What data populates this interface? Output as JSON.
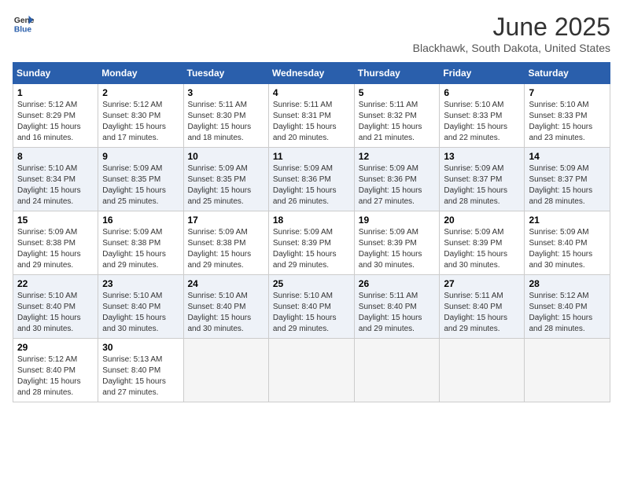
{
  "header": {
    "logo_general": "General",
    "logo_blue": "Blue",
    "title": "June 2025",
    "subtitle": "Blackhawk, South Dakota, United States"
  },
  "weekdays": [
    "Sunday",
    "Monday",
    "Tuesday",
    "Wednesday",
    "Thursday",
    "Friday",
    "Saturday"
  ],
  "weeks": [
    [
      {
        "day": "1",
        "sunrise": "5:12 AM",
        "sunset": "8:29 PM",
        "daylight": "15 hours and 16 minutes."
      },
      {
        "day": "2",
        "sunrise": "5:12 AM",
        "sunset": "8:30 PM",
        "daylight": "15 hours and 17 minutes."
      },
      {
        "day": "3",
        "sunrise": "5:11 AM",
        "sunset": "8:30 PM",
        "daylight": "15 hours and 18 minutes."
      },
      {
        "day": "4",
        "sunrise": "5:11 AM",
        "sunset": "8:31 PM",
        "daylight": "15 hours and 20 minutes."
      },
      {
        "day": "5",
        "sunrise": "5:11 AM",
        "sunset": "8:32 PM",
        "daylight": "15 hours and 21 minutes."
      },
      {
        "day": "6",
        "sunrise": "5:10 AM",
        "sunset": "8:33 PM",
        "daylight": "15 hours and 22 minutes."
      },
      {
        "day": "7",
        "sunrise": "5:10 AM",
        "sunset": "8:33 PM",
        "daylight": "15 hours and 23 minutes."
      }
    ],
    [
      {
        "day": "8",
        "sunrise": "5:10 AM",
        "sunset": "8:34 PM",
        "daylight": "15 hours and 24 minutes."
      },
      {
        "day": "9",
        "sunrise": "5:09 AM",
        "sunset": "8:35 PM",
        "daylight": "15 hours and 25 minutes."
      },
      {
        "day": "10",
        "sunrise": "5:09 AM",
        "sunset": "8:35 PM",
        "daylight": "15 hours and 25 minutes."
      },
      {
        "day": "11",
        "sunrise": "5:09 AM",
        "sunset": "8:36 PM",
        "daylight": "15 hours and 26 minutes."
      },
      {
        "day": "12",
        "sunrise": "5:09 AM",
        "sunset": "8:36 PM",
        "daylight": "15 hours and 27 minutes."
      },
      {
        "day": "13",
        "sunrise": "5:09 AM",
        "sunset": "8:37 PM",
        "daylight": "15 hours and 28 minutes."
      },
      {
        "day": "14",
        "sunrise": "5:09 AM",
        "sunset": "8:37 PM",
        "daylight": "15 hours and 28 minutes."
      }
    ],
    [
      {
        "day": "15",
        "sunrise": "5:09 AM",
        "sunset": "8:38 PM",
        "daylight": "15 hours and 29 minutes."
      },
      {
        "day": "16",
        "sunrise": "5:09 AM",
        "sunset": "8:38 PM",
        "daylight": "15 hours and 29 minutes."
      },
      {
        "day": "17",
        "sunrise": "5:09 AM",
        "sunset": "8:38 PM",
        "daylight": "15 hours and 29 minutes."
      },
      {
        "day": "18",
        "sunrise": "5:09 AM",
        "sunset": "8:39 PM",
        "daylight": "15 hours and 29 minutes."
      },
      {
        "day": "19",
        "sunrise": "5:09 AM",
        "sunset": "8:39 PM",
        "daylight": "15 hours and 30 minutes."
      },
      {
        "day": "20",
        "sunrise": "5:09 AM",
        "sunset": "8:39 PM",
        "daylight": "15 hours and 30 minutes."
      },
      {
        "day": "21",
        "sunrise": "5:09 AM",
        "sunset": "8:40 PM",
        "daylight": "15 hours and 30 minutes."
      }
    ],
    [
      {
        "day": "22",
        "sunrise": "5:10 AM",
        "sunset": "8:40 PM",
        "daylight": "15 hours and 30 minutes."
      },
      {
        "day": "23",
        "sunrise": "5:10 AM",
        "sunset": "8:40 PM",
        "daylight": "15 hours and 30 minutes."
      },
      {
        "day": "24",
        "sunrise": "5:10 AM",
        "sunset": "8:40 PM",
        "daylight": "15 hours and 30 minutes."
      },
      {
        "day": "25",
        "sunrise": "5:10 AM",
        "sunset": "8:40 PM",
        "daylight": "15 hours and 29 minutes."
      },
      {
        "day": "26",
        "sunrise": "5:11 AM",
        "sunset": "8:40 PM",
        "daylight": "15 hours and 29 minutes."
      },
      {
        "day": "27",
        "sunrise": "5:11 AM",
        "sunset": "8:40 PM",
        "daylight": "15 hours and 29 minutes."
      },
      {
        "day": "28",
        "sunrise": "5:12 AM",
        "sunset": "8:40 PM",
        "daylight": "15 hours and 28 minutes."
      }
    ],
    [
      {
        "day": "29",
        "sunrise": "5:12 AM",
        "sunset": "8:40 PM",
        "daylight": "15 hours and 28 minutes."
      },
      {
        "day": "30",
        "sunrise": "5:13 AM",
        "sunset": "8:40 PM",
        "daylight": "15 hours and 27 minutes."
      },
      {
        "day": "",
        "sunrise": "",
        "sunset": "",
        "daylight": ""
      },
      {
        "day": "",
        "sunrise": "",
        "sunset": "",
        "daylight": ""
      },
      {
        "day": "",
        "sunrise": "",
        "sunset": "",
        "daylight": ""
      },
      {
        "day": "",
        "sunrise": "",
        "sunset": "",
        "daylight": ""
      },
      {
        "day": "",
        "sunrise": "",
        "sunset": "",
        "daylight": ""
      }
    ]
  ],
  "labels": {
    "sunrise_prefix": "Sunrise: ",
    "sunset_prefix": "Sunset: ",
    "daylight_prefix": "Daylight: "
  }
}
